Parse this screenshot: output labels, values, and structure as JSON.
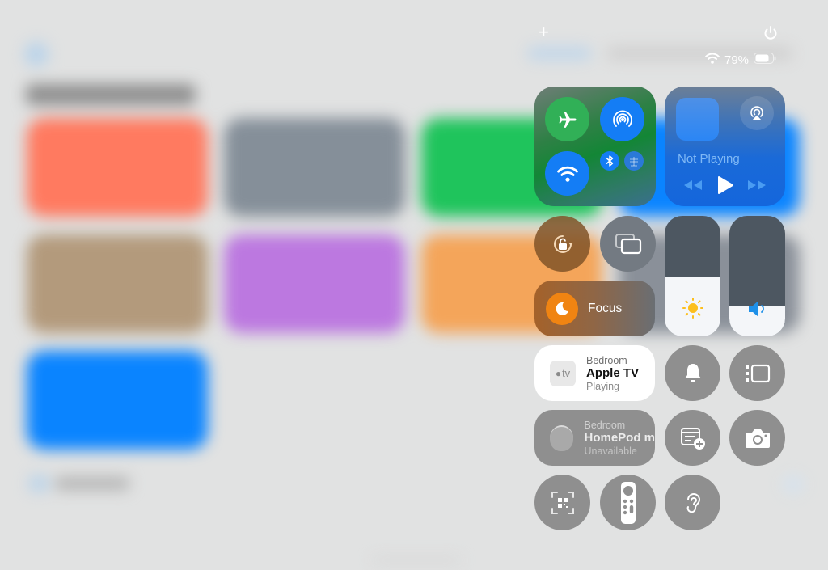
{
  "status_bar": {
    "battery_percent": "79%",
    "battery_level": 0.79,
    "wifi_icon": "wifi-icon",
    "battery_icon": "battery-icon"
  },
  "control_center": {
    "add_icon": "plus-icon",
    "power_icon": "power-icon",
    "connectivity": {
      "airplane_mode": {
        "icon": "airplane-icon",
        "active": true
      },
      "airdrop": {
        "icon": "airdrop-icon",
        "active": true
      },
      "wifi": {
        "icon": "wifi-icon",
        "active": true
      },
      "bluetooth": {
        "icon": "bluetooth-icon",
        "active": true
      },
      "network": {
        "icon": "network-tree-icon",
        "active": true
      }
    },
    "now_playing": {
      "status": "Not Playing",
      "airplay_icon": "airplay-audio-icon",
      "controls": [
        "rewind-icon",
        "play-icon",
        "fast-forward-icon"
      ]
    },
    "orientation_lock": {
      "icon": "rotation-lock-icon"
    },
    "screen_mirroring": {
      "icon": "screen-mirroring-icon"
    },
    "focus": {
      "label": "Focus",
      "icon": "moon-icon"
    },
    "brightness": {
      "level": 0.5,
      "icon": "sun-icon"
    },
    "volume": {
      "level": 0.25,
      "icon": "speaker-icon"
    },
    "apple_tv_tile": {
      "room": "Bedroom",
      "device": "Apple TV",
      "status": "Playing",
      "logo_text": "tv"
    },
    "homepod_tile": {
      "room": "Bedroom",
      "device": "HomePod m",
      "status": "Unavailable"
    },
    "silent_mode": {
      "icon": "bell-icon"
    },
    "stage_manager": {
      "icon": "stage-manager-icon"
    },
    "quick_note": {
      "icon": "quick-note-add-icon"
    },
    "camera": {
      "icon": "camera-icon"
    },
    "code_scanner": {
      "icon": "qr-code-scanner-icon"
    },
    "apple_tv_remote": {
      "icon": "tv-remote-icon"
    },
    "hearing": {
      "icon": "ear-icon"
    }
  },
  "background_app": {
    "title": "All Shortcuts",
    "tile_colors": [
      "#ff7a60",
      "#858f99",
      "#1fc45c",
      "#0a84ff",
      "#b39a7c",
      "#bc78e0",
      "#f4a55a",
      "#0a84ff"
    ]
  }
}
